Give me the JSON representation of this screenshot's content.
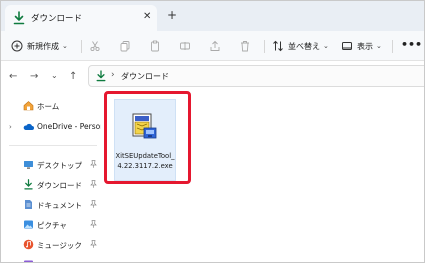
{
  "window": {
    "tab_title": "ダウンロード",
    "tab_close": "✕",
    "new_tab": "+"
  },
  "command_bar": {
    "new_label": "新規作成",
    "sort_label": "並べ替え",
    "view_label": "表示",
    "more": "•••",
    "caret": "⌄"
  },
  "address_bar": {
    "back": "←",
    "forward": "→",
    "up_history": "⌄",
    "up": "↑",
    "separator": "›",
    "path": "ダウンロード"
  },
  "sidebar": {
    "items": [
      {
        "label": "ホーム",
        "icon": "home-icon",
        "pinned": false,
        "expandable": false
      },
      {
        "label": "OneDrive - Persona",
        "icon": "cloud-icon",
        "pinned": false,
        "expandable": true
      },
      {
        "label": "デスクトップ",
        "icon": "desktop-icon",
        "pinned": true,
        "expandable": false
      },
      {
        "label": "ダウンロード",
        "icon": "download-icon",
        "pinned": true,
        "expandable": false
      },
      {
        "label": "ドキュメント",
        "icon": "document-icon",
        "pinned": true,
        "expandable": false
      },
      {
        "label": "ピクチャ",
        "icon": "pictures-icon",
        "pinned": true,
        "expandable": false
      },
      {
        "label": "ミュージック",
        "icon": "music-icon",
        "pinned": true,
        "expandable": false
      }
    ],
    "expander": "›",
    "pin": "📌"
  },
  "content": {
    "file_name": "XitSEUpdateTool_4.22.3117.2.exe"
  },
  "colors": {
    "accent": "#0f7b3f",
    "highlight": "#e5172f",
    "selection": "#e3eefb",
    "onedrive": "#0a64c8"
  }
}
